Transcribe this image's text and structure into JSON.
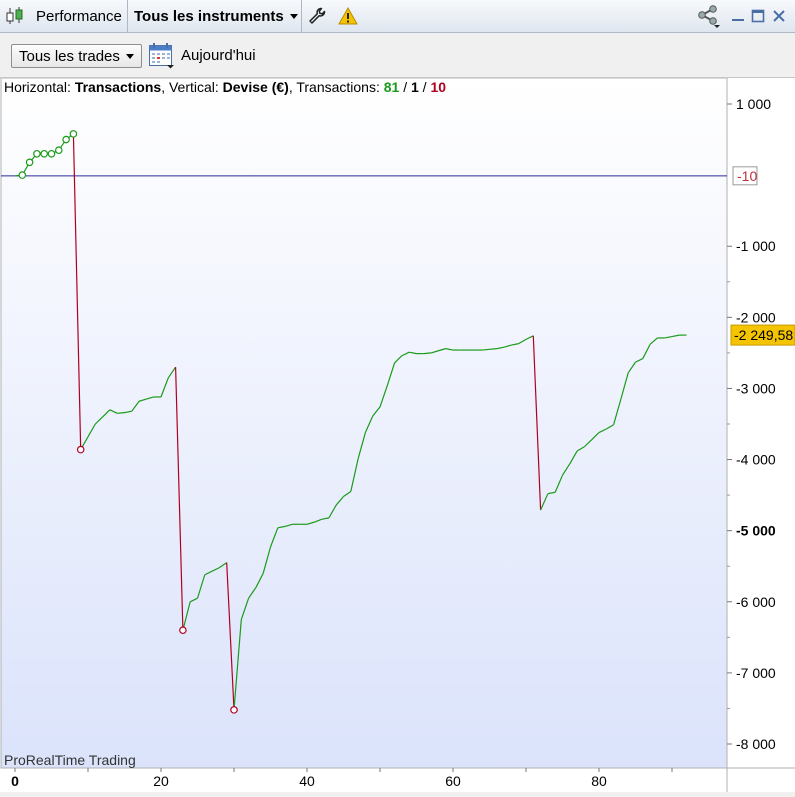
{
  "titlebar": {
    "app_label": "Performance",
    "instrument_label": "Tous les instruments",
    "icons": [
      "candlestick-icon",
      "wrench-icon",
      "warning-icon",
      "share-icon",
      "minimize-icon",
      "maximize-icon",
      "close-icon"
    ]
  },
  "toolbar": {
    "filter_label": "Tous les trades",
    "date_label": "Aujourd'hui",
    "icons": [
      "calendar-icon"
    ]
  },
  "chart_header": {
    "h_prefix": "Horizontal: ",
    "h_value": "Transactions",
    "v_prefix": ", Vertical: ",
    "v_value": "Devise (€)",
    "t_prefix": ", Transactions: ",
    "t_win": "81",
    "slash1": " / ",
    "t_even": "1",
    "slash2": " / ",
    "t_loss": "10"
  },
  "watermark": "ProRealTime Trading",
  "colors": {
    "win": "#1a9a1a",
    "loss": "#b00020",
    "zero_line": "#2a2a9a",
    "current_badge": "#f5c400"
  },
  "chart_data": {
    "type": "line",
    "xlim": [
      0,
      97
    ],
    "ylim": [
      -8300,
      1350
    ],
    "x_ticks": [
      "0",
      "20",
      "40",
      "60",
      "80"
    ],
    "x_tick_values": [
      0,
      20,
      40,
      60,
      80
    ],
    "y_ticks": [
      "1 000",
      "-1 000",
      "-2 000",
      "-3 000",
      "-4 000",
      "-5 000",
      "-6 000",
      "-7 000",
      "-8 000"
    ],
    "y_tick_values": [
      1000,
      -1000,
      -2000,
      -3000,
      -4000,
      -5000,
      -6000,
      -7000,
      -8000
    ],
    "bold_y_tick": "-5 000",
    "zero_marker_value": -10,
    "zero_marker_label": "-10",
    "current_value": -2249.58,
    "current_label": "-2 249,58",
    "values": [
      -10,
      0,
      180,
      300,
      300,
      300,
      350,
      500,
      580,
      -3860,
      -3680,
      -3500,
      -3400,
      -3300,
      -3350,
      -3340,
      -3320,
      -3180,
      -3150,
      -3120,
      -3120,
      -2850,
      -2700,
      -6400,
      -6000,
      -5950,
      -5620,
      -5570,
      -5520,
      -5450,
      -7520,
      -6250,
      -5950,
      -5800,
      -5600,
      -5230,
      -4960,
      -4940,
      -4910,
      -4910,
      -4910,
      -4880,
      -4840,
      -4820,
      -4640,
      -4520,
      -4450,
      -3990,
      -3620,
      -3390,
      -3260,
      -2960,
      -2640,
      -2540,
      -2490,
      -2510,
      -2510,
      -2500,
      -2470,
      -2440,
      -2460,
      -2460,
      -2460,
      -2460,
      -2460,
      -2450,
      -2440,
      -2420,
      -2390,
      -2370,
      -2310,
      -2260,
      -4710,
      -4480,
      -4460,
      -4220,
      -4060,
      -3880,
      -3820,
      -3720,
      -3620,
      -3570,
      -3510,
      -3150,
      -2780,
      -2630,
      -2580,
      -2380,
      -2290,
      -2290,
      -2270,
      -2250,
      -2249.58
    ],
    "loss_indices": [
      9,
      23,
      30,
      72
    ],
    "markers": [
      {
        "x": 1,
        "y": 0,
        "status": "win"
      },
      {
        "x": 2,
        "y": 180,
        "status": "win"
      },
      {
        "x": 3,
        "y": 300,
        "status": "win"
      },
      {
        "x": 4,
        "y": 300,
        "status": "win"
      },
      {
        "x": 5,
        "y": 300,
        "status": "win"
      },
      {
        "x": 6,
        "y": 350,
        "status": "win"
      },
      {
        "x": 7,
        "y": 500,
        "status": "win"
      },
      {
        "x": 8,
        "y": 580,
        "status": "win"
      },
      {
        "x": 9,
        "y": -3860,
        "status": "loss"
      },
      {
        "x": 23,
        "y": -6400,
        "status": "loss"
      },
      {
        "x": 30,
        "y": -7520,
        "status": "loss"
      }
    ]
  }
}
